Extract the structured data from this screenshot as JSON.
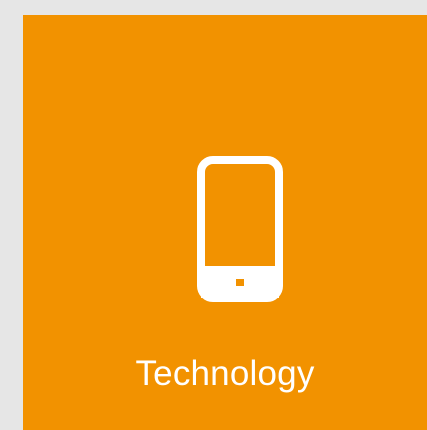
{
  "tile": {
    "label": "Technology",
    "icon": "smartphone-icon",
    "background_color": "#f29200",
    "text_color": "#ffffff"
  },
  "page": {
    "background_color": "#e6e6e6"
  }
}
